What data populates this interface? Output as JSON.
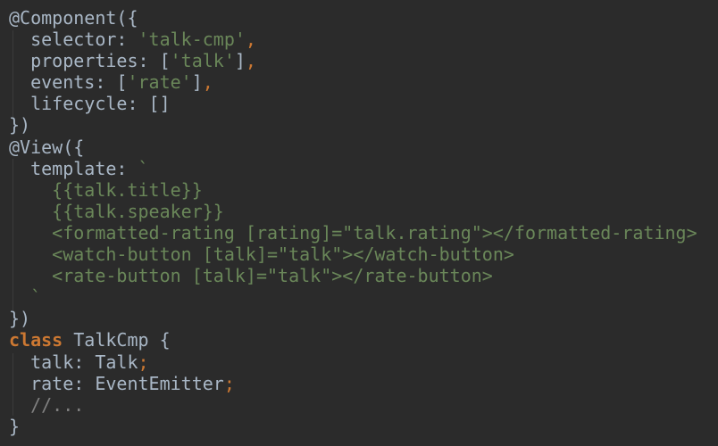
{
  "editor": {
    "colors": {
      "background": "#2b2b2b",
      "plain": "#a9b7c6",
      "string": "#6a8759",
      "keyword": "#cc7832",
      "comment": "#808080"
    },
    "lines": [
      [
        [
          "plain",
          "@Component({"
        ]
      ],
      [
        [
          "plain",
          "  selector: "
        ],
        [
          "str",
          "'talk-cmp'"
        ],
        [
          "punc",
          ","
        ]
      ],
      [
        [
          "plain",
          "  properties: ["
        ],
        [
          "str",
          "'talk'"
        ],
        [
          "plain",
          "]"
        ],
        [
          "punc",
          ","
        ]
      ],
      [
        [
          "plain",
          "  events: ["
        ],
        [
          "str",
          "'rate'"
        ],
        [
          "plain",
          "]"
        ],
        [
          "punc",
          ","
        ]
      ],
      [
        [
          "plain",
          "  lifecycle: []"
        ]
      ],
      [
        [
          "plain",
          "})"
        ]
      ],
      [
        [
          "plain",
          "@View({"
        ]
      ],
      [
        [
          "plain",
          "  template: "
        ],
        [
          "str",
          "`"
        ]
      ],
      [
        [
          "str",
          "    {{talk.title}}"
        ]
      ],
      [
        [
          "str",
          "    {{talk.speaker}}"
        ]
      ],
      [
        [
          "str",
          "    <formatted-rating [rating]=\"talk.rating\"></formatted-rating>"
        ]
      ],
      [
        [
          "str",
          "    <watch-button [talk]=\"talk\"></watch-button>"
        ]
      ],
      [
        [
          "str",
          "    <rate-button [talk]=\"talk\"></rate-button>"
        ]
      ],
      [
        [
          "str",
          "  `"
        ]
      ],
      [
        [
          "plain",
          "})"
        ]
      ],
      [
        [
          "kw",
          "class"
        ],
        [
          "plain",
          " TalkCmp {"
        ]
      ],
      [
        [
          "plain",
          "  talk: Talk"
        ],
        [
          "punc",
          ";"
        ]
      ],
      [
        [
          "plain",
          "  rate: EventEmitter"
        ],
        [
          "punc",
          ";"
        ]
      ],
      [
        [
          "com",
          "  //..."
        ]
      ],
      [
        [
          "plain",
          "}"
        ]
      ]
    ]
  }
}
